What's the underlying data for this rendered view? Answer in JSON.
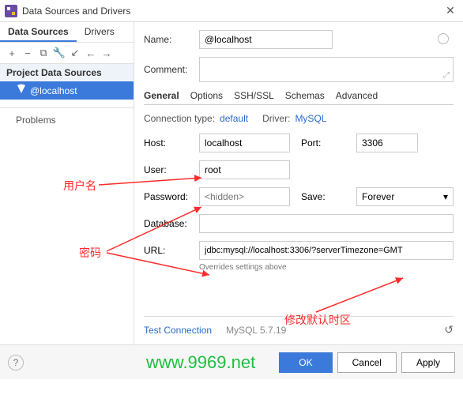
{
  "window": {
    "title": "Data Sources and Drivers"
  },
  "left": {
    "tabs": [
      "Data Sources",
      "Drivers"
    ],
    "section": "Project Data Sources",
    "item": "@localhost",
    "problems": "Problems"
  },
  "form": {
    "name_label": "Name:",
    "name_value": "@localhost",
    "comment_label": "Comment:",
    "tabs": [
      "General",
      "Options",
      "SSH/SSL",
      "Schemas",
      "Advanced"
    ],
    "conn_type_label": "Connection type:",
    "conn_type_value": "default",
    "driver_label": "Driver:",
    "driver_value": "MySQL",
    "host_label": "Host:",
    "host_value": "localhost",
    "port_label": "Port:",
    "port_value": "3306",
    "user_label": "User:",
    "user_value": "root",
    "password_label": "Password:",
    "password_placeholder": "<hidden>",
    "save_label": "Save:",
    "save_value": "Forever",
    "database_label": "Database:",
    "database_value": "",
    "url_label": "URL:",
    "url_value": "jdbc:mysql://localhost:3306/?serverTimezone=GMT",
    "overrides": "Overrides settings above",
    "test": "Test Connection",
    "version": "MySQL 5.7.19"
  },
  "footer": {
    "ok": "OK",
    "cancel": "Cancel",
    "apply": "Apply"
  },
  "annotations": {
    "user": "用户名",
    "password": "密码",
    "timezone": "修改默认时区"
  },
  "watermark": "www.9969.net"
}
